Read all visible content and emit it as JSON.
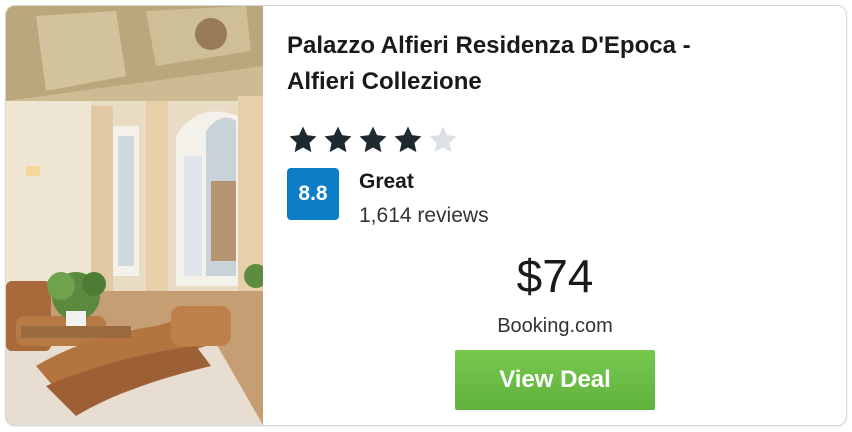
{
  "hotel": {
    "name_line1": "Palazzo Alfieri Residenza D'Epoca -",
    "name_line2": "Alfieri Collezione",
    "photo_alt": "Hotel room photo",
    "star_rating": 4,
    "star_max": 5
  },
  "rating": {
    "score": "8.8",
    "label": "Great",
    "reviews": "1,614 reviews"
  },
  "deal": {
    "price": "$74",
    "provider": "Booking.com",
    "button_label": "View Deal"
  },
  "colors": {
    "rating_badge": "#0c7dc7",
    "button": "#6cc04a",
    "star_filled": "#1f2a30",
    "star_empty": "#dbe1e6"
  }
}
